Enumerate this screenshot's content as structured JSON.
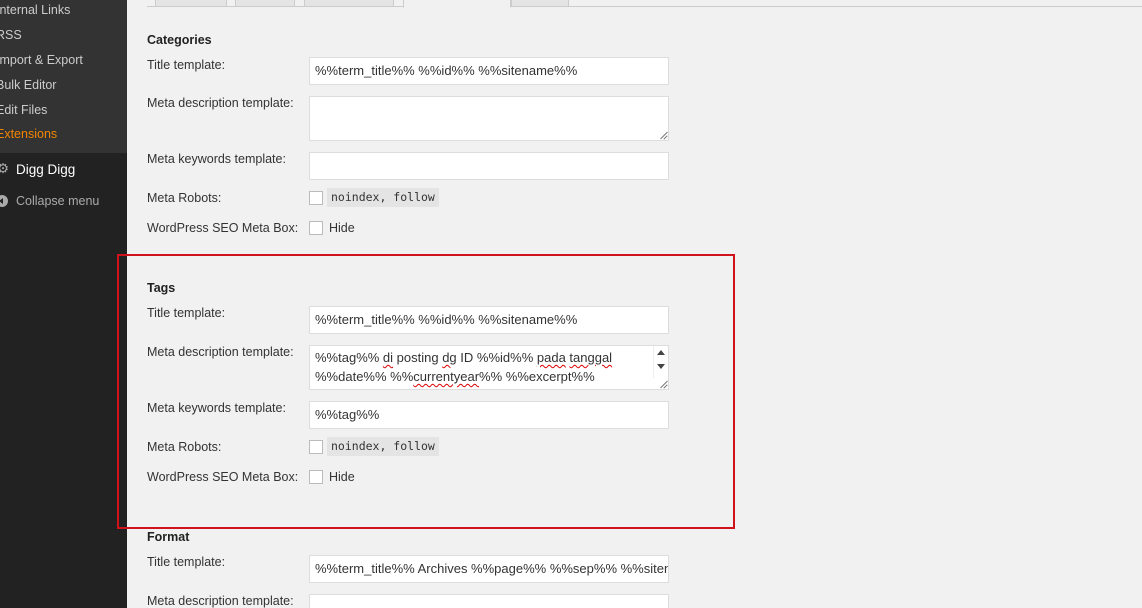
{
  "sidebar": {
    "submenu": [
      {
        "label": "Internal Links"
      },
      {
        "label": "RSS"
      },
      {
        "label": "Import & Export"
      },
      {
        "label": "Bulk Editor"
      },
      {
        "label": "Edit Files"
      },
      {
        "label": "Extensions",
        "current": true
      }
    ],
    "digg_digg": "Digg Digg",
    "collapse": "Collapse menu"
  },
  "sections": {
    "categories": {
      "heading": "Categories",
      "title_label": "Title template:",
      "title_value": "%%term_title%% %%id%% %%sitename%%",
      "metadesc_label": "Meta description template:",
      "metadesc_value": "",
      "metakey_label": "Meta keywords template:",
      "metakey_value": "",
      "robots_label": "Meta Robots:",
      "robots_code": "noindex, follow",
      "metabox_label": "WordPress SEO Meta Box:",
      "metabox_hide": "Hide"
    },
    "tags": {
      "heading": "Tags",
      "title_label": "Title template:",
      "title_value": "%%term_title%% %%id%% %%sitename%%",
      "metadesc_label": "Meta description template:",
      "metadesc_line1_a": "%%tag%% ",
      "metadesc_line1_b": "di",
      "metadesc_line1_c": " posting ",
      "metadesc_line1_d": "dg",
      "metadesc_line1_e": " ID %%id%% ",
      "metadesc_line1_f": "pada",
      "metadesc_line1_g": " ",
      "metadesc_line1_h": "tanggal",
      "metadesc_line2_a": "%%date%% %%",
      "metadesc_line2_b": "currentyear",
      "metadesc_line2_c": "%% %%excerpt%%",
      "metakey_label": "Meta keywords template:",
      "metakey_value": "%%tag%%",
      "robots_label": "Meta Robots:",
      "robots_code": "noindex, follow",
      "metabox_label": "WordPress SEO Meta Box:",
      "metabox_hide": "Hide"
    },
    "format": {
      "heading": "Format",
      "title_label": "Title template:",
      "title_value": "%%term_title%% Archives %%page%% %%sep%% %%sitename%%",
      "metadesc_label": "Meta description template:"
    }
  },
  "colors": {
    "highlight_box": "#d0121b",
    "current_menu": "#f18500"
  }
}
